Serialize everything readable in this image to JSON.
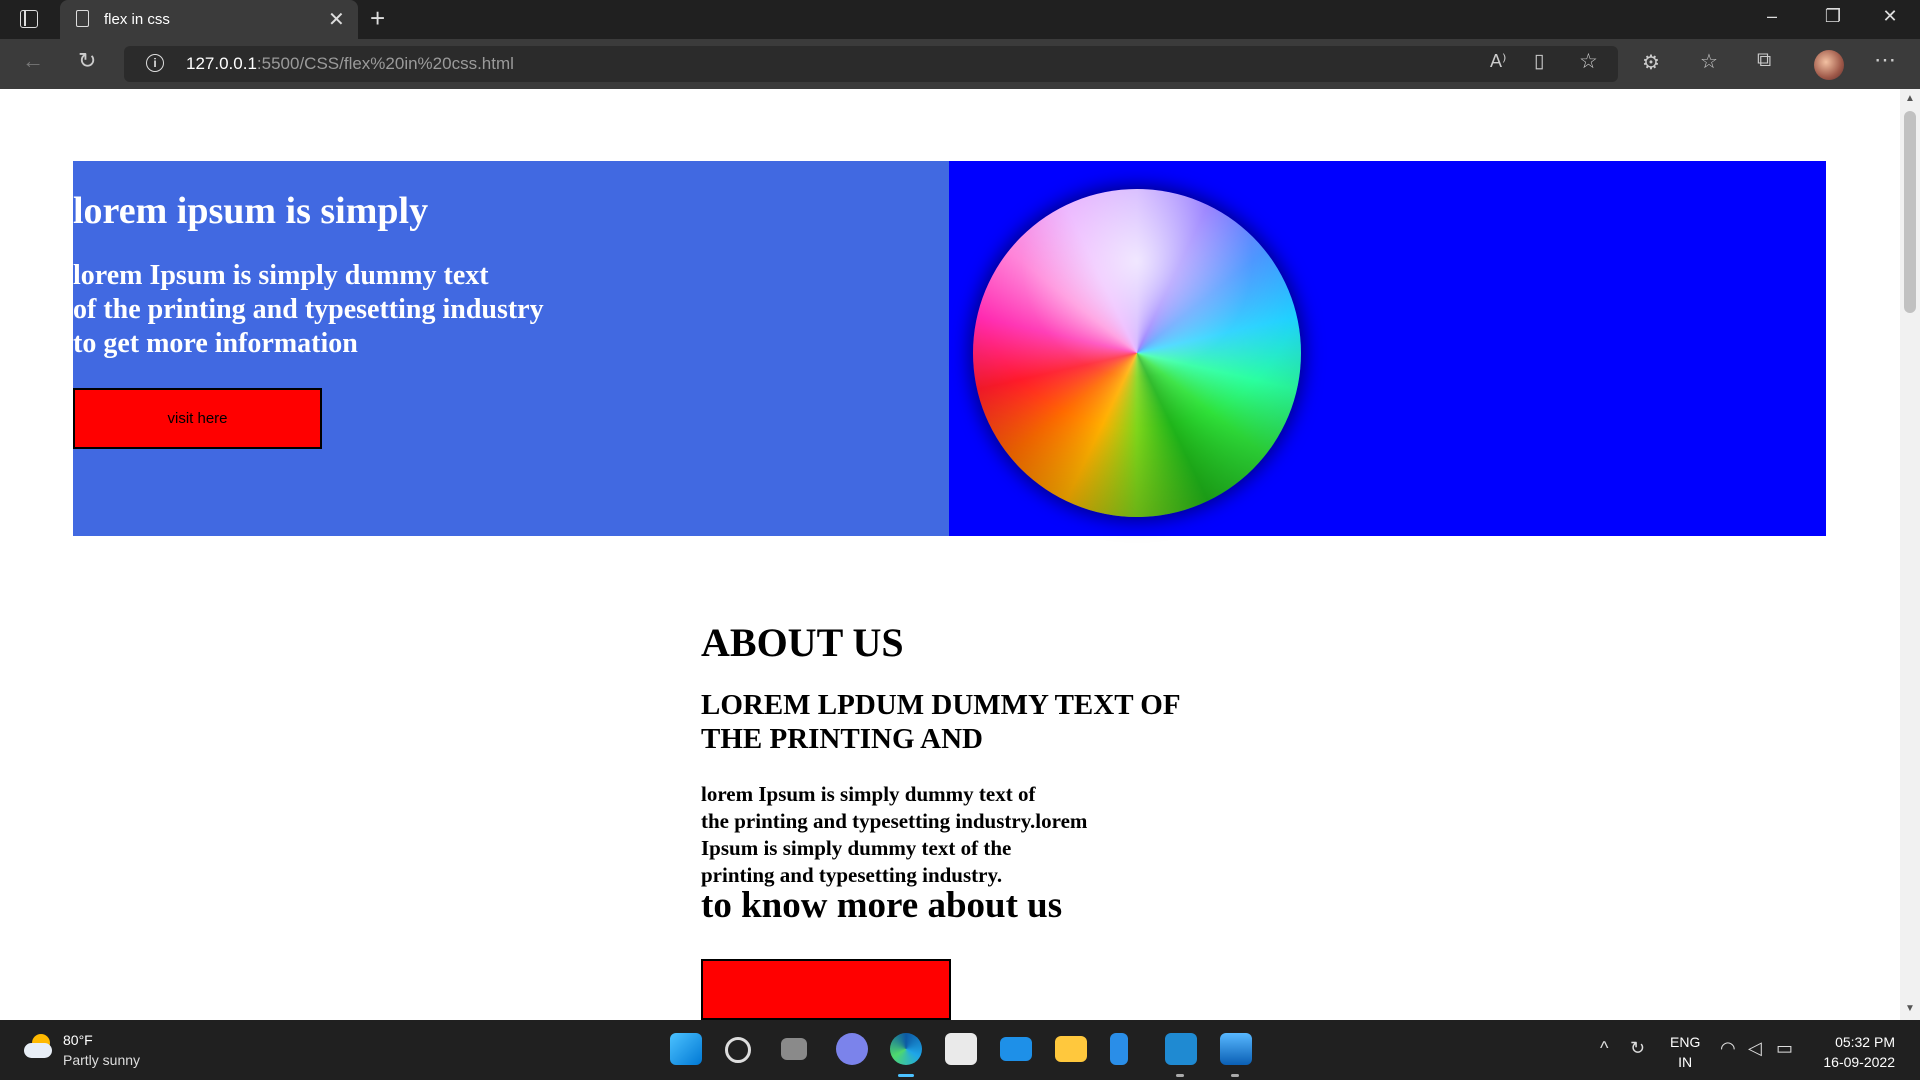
{
  "browser": {
    "tab_title": "flex in css",
    "url_host": "127.0.0.1",
    "url_path": ":5500/CSS/flex%20in%20css.html"
  },
  "hero": {
    "title": "lorem ipsum is simply",
    "text": "lorem Ipsum is simply dummy text\nof the printing and typesetting industry\nto get more information",
    "button_label": "visit here",
    "left_color": "#4169e1",
    "right_color": "#0000ff"
  },
  "about": {
    "title": "ABOUT US",
    "subtitle": "LOREM LPDUM DUMMY TEXT OF\nTHE PRINTING AND",
    "text": "lorem Ipsum is simply dummy text of\nthe printing and typesetting industry.lorem\nIpsum is simply dummy text of the\nprinting and typesetting industry.",
    "more_heading": "to know more about us"
  },
  "taskbar": {
    "weather_temp": "80°F",
    "weather_desc": "Partly sunny",
    "lang_line1": "ENG",
    "lang_line2": "IN",
    "time": "05:32 PM",
    "date": "16-09-2022"
  },
  "icons": {
    "tab_actions": "tab-actions-icon",
    "page": "page-icon",
    "close": "close-icon",
    "new_tab": "plus-icon",
    "back": "back-arrow-icon",
    "refresh": "refresh-icon",
    "site_info": "info-icon",
    "read_aloud": "read-aloud-icon",
    "immersive_reader": "immersive-reader-icon",
    "favorite": "star-add-icon",
    "extensions": "puzzle-icon",
    "favorites": "favorites-list-icon",
    "collections": "collections-icon",
    "more": "more-dots-icon"
  }
}
